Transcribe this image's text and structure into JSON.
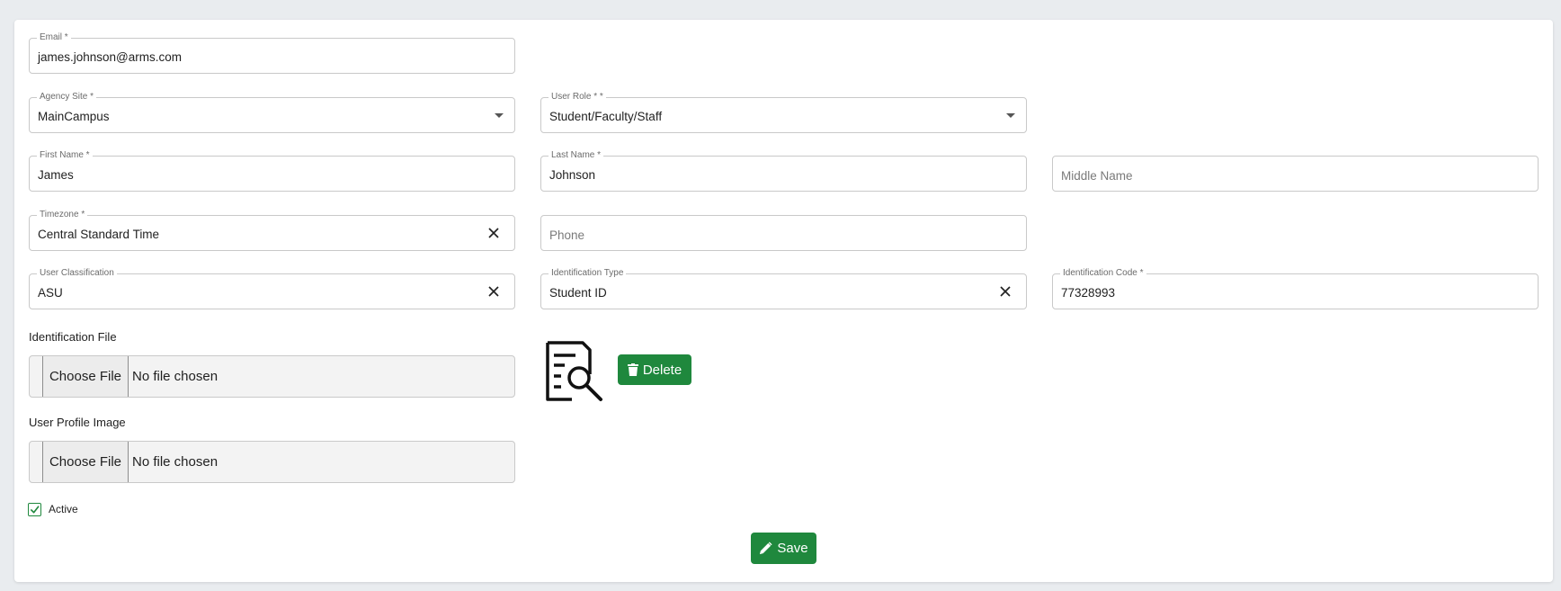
{
  "form": {
    "email": {
      "label": "Email *",
      "value": "james.johnson@arms.com"
    },
    "agency_site": {
      "label": "Agency Site *",
      "value": "MainCampus"
    },
    "user_role": {
      "label": "User Role * *",
      "value": "Student/Faculty/Staff"
    },
    "first_name": {
      "label": "First Name *",
      "value": "James"
    },
    "last_name": {
      "label": "Last Name *",
      "value": "Johnson"
    },
    "middle_name": {
      "placeholder": "Middle Name"
    },
    "timezone": {
      "label": "Timezone *",
      "value": "Central Standard Time"
    },
    "phone": {
      "placeholder": "Phone"
    },
    "user_classification": {
      "label": "User Classification",
      "value": "ASU"
    },
    "identification_type": {
      "label": "Identification Type",
      "value": "Student ID"
    },
    "identification_code": {
      "label": "Identification Code *",
      "value": "77328993"
    },
    "identification_file": {
      "label": "Identification File",
      "button": "Choose File",
      "status": "No file chosen"
    },
    "user_profile_image": {
      "label": "User Profile Image",
      "button": "Choose File",
      "status": "No file chosen"
    },
    "delete_button": "Delete",
    "active": {
      "label": "Active",
      "checked": true
    },
    "save_button": "Save"
  },
  "icons": {
    "document_search": "document-search-icon",
    "trash": "trash-icon",
    "pencil": "pencil-icon",
    "clear": "close-icon",
    "dropdown": "chevron-down-icon",
    "check": "check-icon"
  },
  "colors": {
    "accent": "#1f883d",
    "background": "#e9ecef",
    "card": "#ffffff"
  }
}
